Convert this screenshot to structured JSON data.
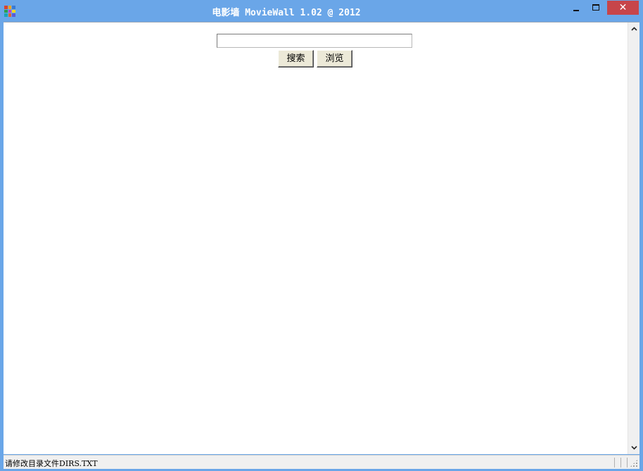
{
  "window": {
    "title": "电影墙 MovieWall 1.02 @ 2012",
    "close_glyph": "✕",
    "icon_colors": [
      "#d9442b",
      "#f2a51a",
      "#3a7bd5",
      "#2e9e4a",
      "#c63ad1",
      "#f5d31d",
      "#1aa6b7",
      "#e2642d",
      "#5b5bd6"
    ]
  },
  "search": {
    "value": "",
    "placeholder": ""
  },
  "buttons": {
    "search_label": "搜索",
    "browse_label": "浏览"
  },
  "scrollbar": {
    "up_glyph": "▲",
    "down_glyph": "▼"
  },
  "status": {
    "text": "请修改目录文件DIRS.TXT"
  }
}
